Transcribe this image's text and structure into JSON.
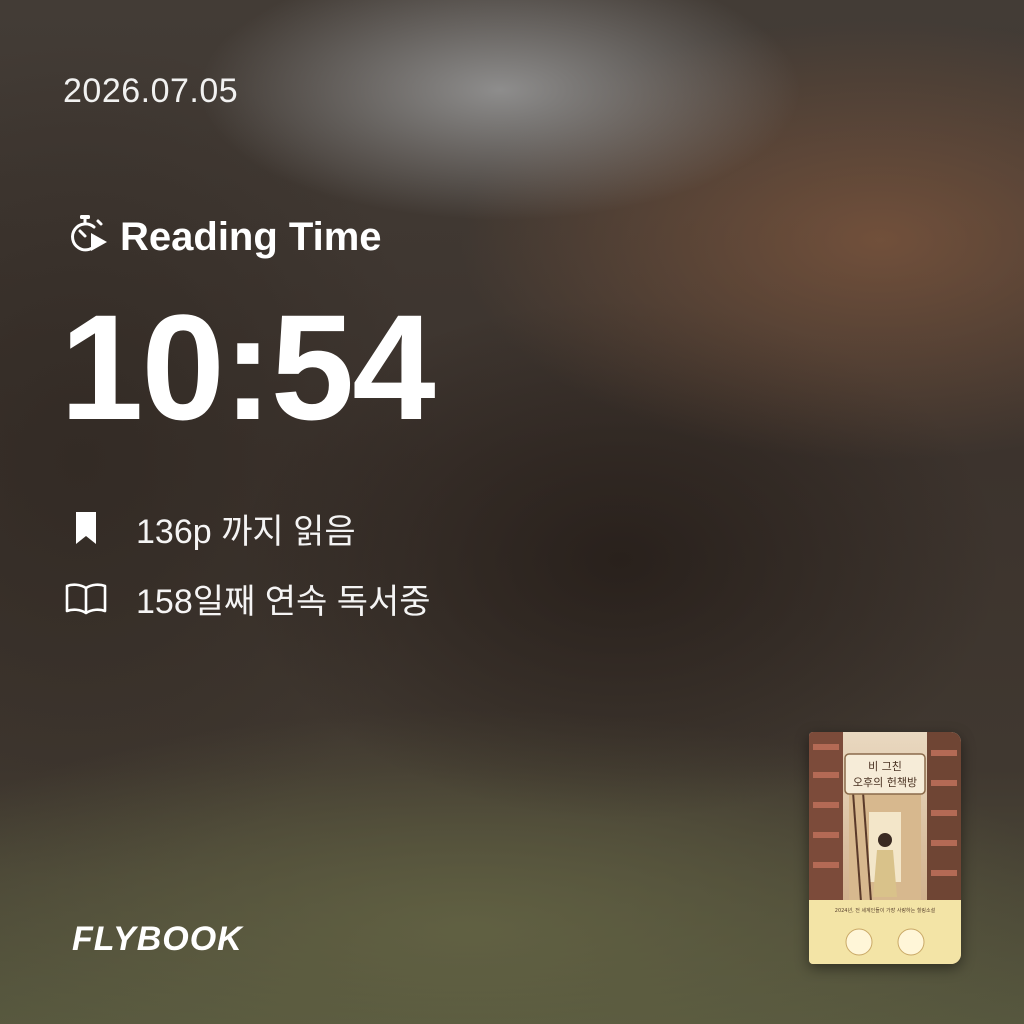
{
  "date": "2026.07.05",
  "reading_time": {
    "label": "Reading Time",
    "icon": "stopwatch-play-icon",
    "value": "10:54"
  },
  "stats": [
    {
      "icon": "bookmark-icon",
      "text": "136p 까지 읽음"
    },
    {
      "icon": "open-book-icon",
      "text": "158일째 연속 독서중"
    }
  ],
  "brand": "FLYBOOK",
  "book_cover": {
    "title_line1": "비 그친",
    "title_line2": "오후의 헌책방",
    "tagline": "2024년, 전 세계인들이 가장 사랑하는 힐링소설"
  }
}
